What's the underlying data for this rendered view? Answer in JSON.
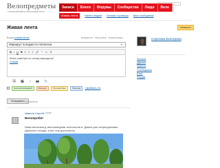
{
  "header": {
    "logo": "Велопредметы",
    "slogan": "слоган вебсайта или мелкий текст"
  },
  "mainnav": {
    "items": [
      "Записи",
      "Блоги",
      "Форумы",
      "Сообщества",
      "Люди",
      "Вело"
    ]
  },
  "subnav": {
    "items": [
      "Живая лента",
      "Найти людей",
      "Личная страница",
      "Мои сообщения"
    ]
  },
  "page": {
    "title": "Живая лента",
    "write_button": "Написать"
  },
  "editor": {
    "blog_label": "Блога",
    "blog_value": "в моём блоге",
    "right_links": "Избранное · Настройки · Новая запись",
    "title_value": "Маршрут поездки по Натангии",
    "toolbar": [
      "B",
      "I",
      "U",
      "S",
      "≡",
      "≡",
      "≡",
      "🔗",
      "“”",
      "☺",
      "✎"
    ],
    "text_line": "Всем советую по этому маршруту!",
    "text_link": "Схема",
    "attach": [
      "🖼",
      "🎬",
      "♫",
      "📷",
      "📎"
    ],
    "tags": [
      "Нов велосипедный",
      "Маршрут",
      "Путешествие",
      "Природа"
    ],
    "add_tag": "Добавить тэг"
  },
  "actions": {
    "send": "Отправить",
    "cancel": "Отменить"
  },
  "post": {
    "author": "Иванов Сергей",
    "meta": "→ Кутак",
    "title": "Велопробег",
    "text": "Ниже велосипед, велосипедная технология в. Давно уже непреодолимы. Дальнего похода, и вот они достигнуты."
  },
  "sidebar": {
    "profile_name": "Сергеева Екатерина",
    "menu": [
      "Записи",
      "Друзья",
      "Группы",
      "Сообщения",
      "Блог",
      "Форум"
    ]
  }
}
